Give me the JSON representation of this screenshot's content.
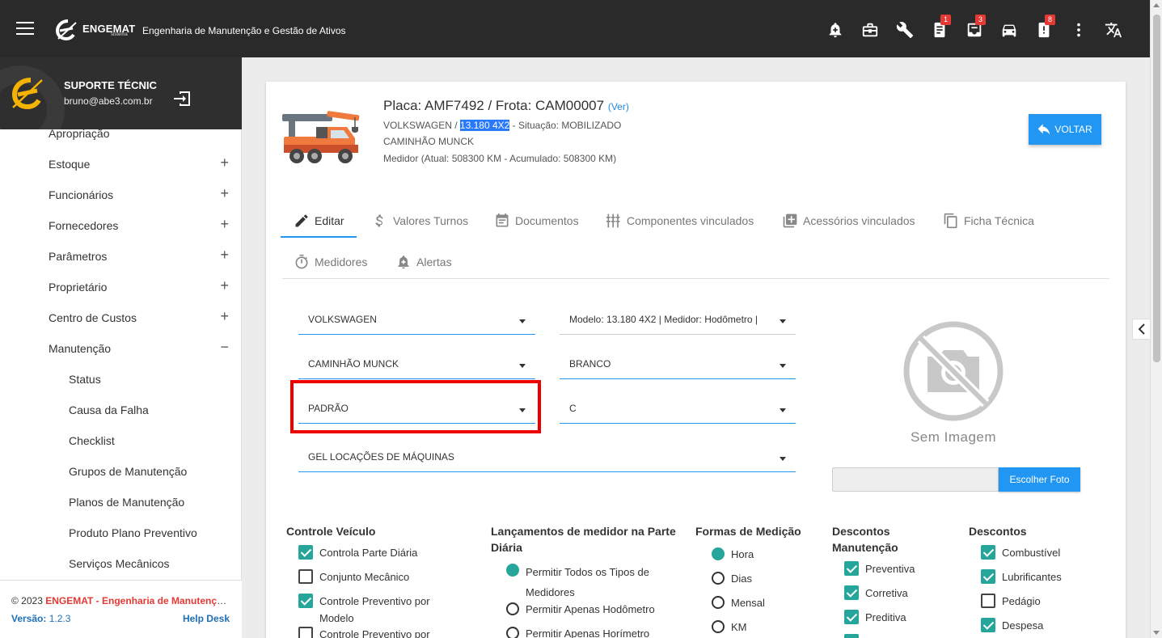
{
  "header": {
    "brand_name": "ENGEMAT",
    "brand_sub": "sistema",
    "app_title": "Engenharia de Manutenção e Gestão de Ativos",
    "icons": [
      {
        "name": "bell-plus-icon",
        "badge": ""
      },
      {
        "name": "briefcase-icon",
        "badge": ""
      },
      {
        "name": "wrench-icon",
        "badge": ""
      },
      {
        "name": "clipboard-icon",
        "badge": "1"
      },
      {
        "name": "inbox-icon",
        "badge": "3"
      },
      {
        "name": "car-icon",
        "badge": ""
      },
      {
        "name": "alert-note-icon",
        "badge": "8"
      },
      {
        "name": "more-vert-icon",
        "badge": ""
      },
      {
        "name": "translate-icon",
        "badge": ""
      }
    ]
  },
  "sidebar": {
    "user_name": "SUPORTE TÉCNIC",
    "user_email": "bruno@abe3.com.br",
    "partial_item": "Apropriação",
    "items": [
      {
        "label": "Estoque",
        "toggle": "+"
      },
      {
        "label": "Funcionários",
        "toggle": "+"
      },
      {
        "label": "Fornecedores",
        "toggle": "+"
      },
      {
        "label": "Parâmetros",
        "toggle": "+"
      },
      {
        "label": "Proprietário",
        "toggle": "+"
      },
      {
        "label": "Centro de Custos",
        "toggle": "+"
      },
      {
        "label": "Manutenção",
        "toggle": "−"
      }
    ],
    "subitems": [
      "Status",
      "Causa da Falha",
      "Checklist",
      "Grupos de Manutenção",
      "Planos de Manutenção",
      "Produto Plano Preventivo",
      "Serviços Mecânicos"
    ],
    "footer": {
      "copyright_prefix": "© 2023 ",
      "copyright_brand": "ENGEMAT - Engenharia de Manutenção e Gestão de Ativos",
      "version_label": "Versão:",
      "version_value": " 1.2.3",
      "help": "Help Desk"
    }
  },
  "vehicle": {
    "plate_line": "Placa: AMF7492 / Frota: CAM00007",
    "ver_link": "(Ver)",
    "brand": "VOLKSWAGEN / ",
    "model": "13.180 4X2",
    "status": " - Situação: MOBILIZADO",
    "type": "CAMINHÃO MUNCK",
    "meter": "Medidor (Atual: 508300 KM - Acumulado: 508300 KM)"
  },
  "buttons": {
    "back": "VOLTAR",
    "choose_photo": "Escolher Foto"
  },
  "tabs": [
    {
      "label": "Editar",
      "icon": "pencil-icon"
    },
    {
      "label": "Valores Turnos",
      "icon": "dollar-icon"
    },
    {
      "label": "Documentos",
      "icon": "calendar-doc-icon"
    },
    {
      "label": "Componentes vinculados",
      "icon": "components-icon"
    },
    {
      "label": "Acessórios vinculados",
      "icon": "add-box-icon"
    },
    {
      "label": "Ficha Técnica",
      "icon": "copy-icon"
    },
    {
      "label": "Medidores",
      "icon": "timer-icon"
    },
    {
      "label": "Alertas",
      "icon": "bell-plus-icon"
    }
  ],
  "form": {
    "marca": "VOLKSWAGEN",
    "modelo": "Modelo: 13.180 4X2 | Medidor: Hodômetro | ",
    "tipo": "CAMINHÃO MUNCK",
    "cor": "BRANCO",
    "padrao": "PADRÃO",
    "categoria": "C",
    "proprietario": "GEL LOCAÇÕES DE MÁQUINAS"
  },
  "image": {
    "no_image_text": "Sem Imagem"
  },
  "sections": {
    "controle_veiculo": {
      "title": "Controle Veículo",
      "items": [
        {
          "label": "Controla Parte Diária",
          "checked": true
        },
        {
          "label": "Conjunto Mecânico",
          "checked": false
        },
        {
          "label": "Controle Preventivo por Modelo",
          "checked": true
        },
        {
          "label": "Controle Preventivo por",
          "checked": false
        }
      ]
    },
    "lancamentos": {
      "title": "Lançamentos de medidor na Parte Diária",
      "options": [
        {
          "label": "Permitir Todos os Tipos de Medidores",
          "selected": true
        },
        {
          "label": "Permitir Apenas Hodômetro",
          "selected": false
        },
        {
          "label": "Permitir Apenas Horímetro",
          "selected": false
        }
      ]
    },
    "formas_medicao": {
      "title": "Formas de Medição",
      "options": [
        {
          "label": "Hora",
          "selected": true
        },
        {
          "label": "Dias",
          "selected": false
        },
        {
          "label": "Mensal",
          "selected": false
        },
        {
          "label": "KM",
          "selected": false
        }
      ]
    },
    "descontos_manutencao": {
      "title": "Descontos Manutenção",
      "items": [
        {
          "label": "Preventiva",
          "checked": true
        },
        {
          "label": "Corretiva",
          "checked": true
        },
        {
          "label": "Preditiva",
          "checked": true
        }
      ]
    },
    "descontos": {
      "title": "Descontos",
      "items": [
        {
          "label": "Combustível",
          "checked": true
        },
        {
          "label": "Lubrificantes",
          "checked": true
        },
        {
          "label": "Pedágio",
          "checked": false
        },
        {
          "label": "Despesa",
          "checked": true
        }
      ]
    }
  },
  "colors": {
    "topbar": "#2a2a2a",
    "accent": "#2196f3",
    "checked": "#26a69a",
    "highlight_box": "#e00000",
    "brand_red": "#e53935"
  }
}
